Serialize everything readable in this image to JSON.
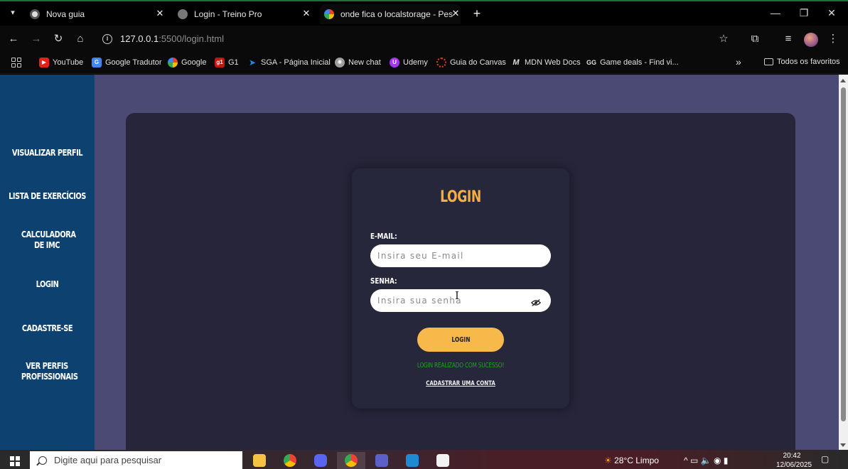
{
  "browser": {
    "tabs": [
      {
        "title": "Nova guia",
        "icon": "chrome-newtab-icon"
      },
      {
        "title": "Login - Treino Pro",
        "icon": "globe-icon"
      },
      {
        "title": "onde fica o localstorage - Pesqu",
        "icon": "google-icon"
      }
    ],
    "url_host": "127.0.0.1",
    "url_path": ":5500/login.html",
    "bookmarks": [
      {
        "label": "YouTube",
        "icon": "youtube-icon",
        "color": "#e62117"
      },
      {
        "label": "Google Tradutor",
        "icon": "translate-icon",
        "color": "#4285f4"
      },
      {
        "label": "Google",
        "icon": "google-icon",
        "color": "#ea4335"
      },
      {
        "label": "G1",
        "icon": "g1-icon",
        "color": "#c4170c"
      },
      {
        "label": "SGA - Página Inicial",
        "icon": "sga-icon",
        "color": "#1e88e5"
      },
      {
        "label": "New chat",
        "icon": "chatgpt-icon",
        "color": "#9e9e9e"
      },
      {
        "label": "Udemy",
        "icon": "udemy-icon",
        "color": "#a435f0"
      },
      {
        "label": "Guia do Canvas",
        "icon": "canvas-icon",
        "color": "#e13c23"
      },
      {
        "label": "MDN Web Docs",
        "icon": "mdn-icon",
        "color": "#555555"
      },
      {
        "label": "Game deals - Find vi...",
        "icon": "gg-icon",
        "color": "#3a3a3a"
      }
    ],
    "bookmarks_overflow": "»",
    "all_bookmarks": "Todos os favoritos"
  },
  "sidebar": {
    "items": [
      {
        "label": "Visualizar perfil"
      },
      {
        "label": "Lista de exercícios"
      },
      {
        "label": "Calculadora de IMC"
      },
      {
        "label": "Login"
      },
      {
        "label": "Cadastre-se"
      },
      {
        "label": "Ver perfis profissionais"
      }
    ]
  },
  "login": {
    "title": "LOGIN",
    "email_label": "E-MAIL:",
    "email_placeholder": "Insira seu E-mail",
    "password_label": "SENHA:",
    "password_placeholder": "Insira sua senha",
    "button_label": "LOGIN",
    "success_message": "LOGIN REALIZADO COM SUCESSO!",
    "register_link": "CADASTRAR UMA CONTA"
  },
  "colors": {
    "sidebar": "#0d4270",
    "page_bg": "#4a4a75",
    "panel": "#26253a",
    "accent": "#f5b041",
    "success": "#1fa01f"
  },
  "taskbar": {
    "search_placeholder": "Digite aqui para pesquisar",
    "weather": "28°C  Limpo",
    "time": "20:42",
    "date": "12/06/2025"
  }
}
